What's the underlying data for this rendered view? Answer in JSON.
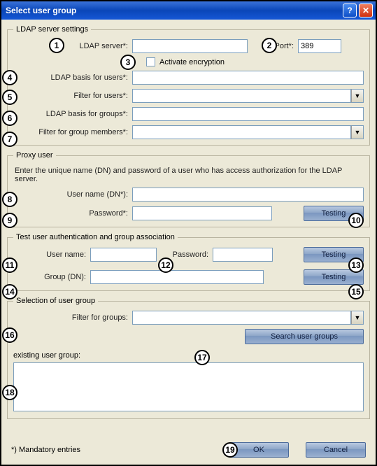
{
  "title": "Select user group",
  "ldap": {
    "legend": "LDAP server settings",
    "server_label": "LDAP server*:",
    "server_value": "",
    "port_label": "Port*:",
    "port_value": "389",
    "encrypt_label": "Activate encryption",
    "basis_users_label": "LDAP basis for users*:",
    "basis_users_value": "",
    "filter_users_label": "Filter for users*:",
    "filter_users_value": "",
    "basis_groups_label": "LDAP basis for groups*:",
    "basis_groups_value": "",
    "filter_group_members_label": "Filter for group members*:",
    "filter_group_members_value": ""
  },
  "proxy": {
    "legend": "Proxy user",
    "note": "Enter the unique name (DN) and password of a user who has access authorization for the LDAP server.",
    "username_label": "User name (DN*):",
    "username_value": "",
    "password_label": "Password*:",
    "password_value": "",
    "testing_label": "Testing"
  },
  "test": {
    "legend": "Test user authentication and group association",
    "username_label": "User name:",
    "username_value": "",
    "password_label": "Password:",
    "password_value": "",
    "group_label": "Group (DN):",
    "group_value": "",
    "testing_label": "Testing"
  },
  "selection": {
    "legend": "Selection of user group",
    "filter_label": "Filter for groups:",
    "filter_value": "",
    "search_label": "Search user groups",
    "existing_label": "existing user group:"
  },
  "footer": {
    "mandatory": "*) Mandatory entries",
    "ok": "OK",
    "cancel": "Cancel"
  }
}
